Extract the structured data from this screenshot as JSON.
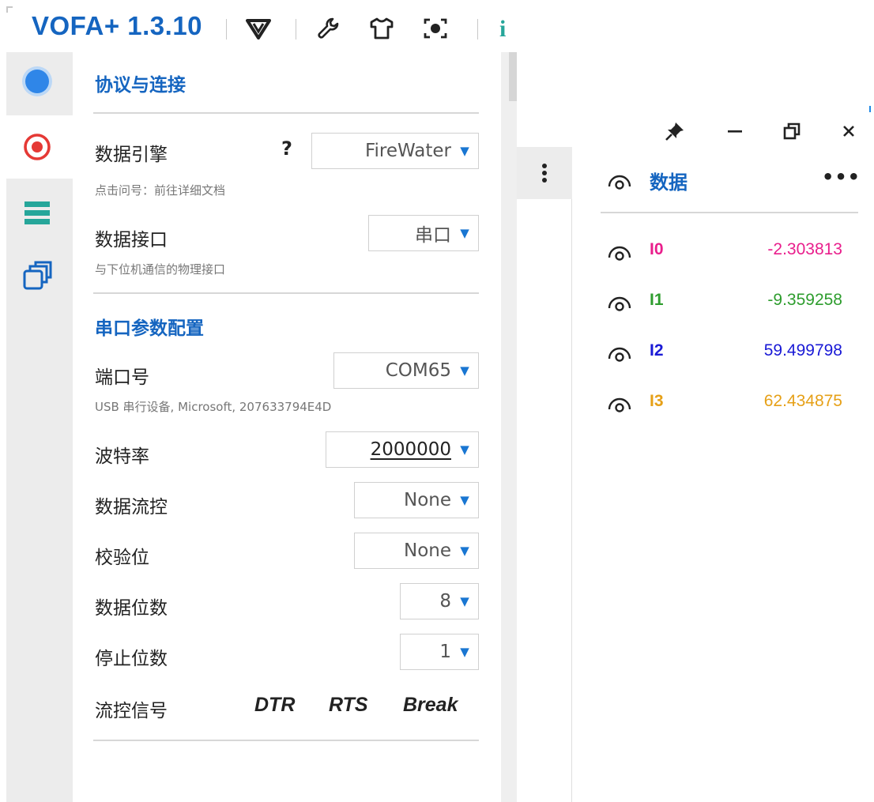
{
  "app": {
    "title": "VOFA+ 1.3.10",
    "clip_glyph": "i"
  },
  "toolbar": {
    "icons": [
      "vofa-logo-icon",
      "wrench-icon",
      "shirt-icon",
      "record-icon"
    ]
  },
  "rail": {
    "icons": [
      "blue-dot-icon",
      "target-icon",
      "list-icon",
      "windows-icon"
    ],
    "active_index": 1
  },
  "settings": {
    "section_connection": "协议与连接",
    "engine": {
      "label": "数据引擎",
      "help": "?",
      "value": "FireWater",
      "hint": "点击问号：前往详细文档"
    },
    "interface": {
      "label": "数据接口",
      "value": "串口",
      "hint": "与下位机通信的物理接口"
    },
    "section_serial": "串口参数配置",
    "port": {
      "label": "端口号",
      "value": "COM65",
      "hint": "USB 串行设备, Microsoft, 207633794E4D"
    },
    "baud": {
      "label": "波特率",
      "value": "2000000"
    },
    "flow": {
      "label": "数据流控",
      "value": "None"
    },
    "parity": {
      "label": "校验位",
      "value": "None"
    },
    "databits": {
      "label": "数据位数",
      "value": "8"
    },
    "stopbits": {
      "label": "停止位数",
      "value": "1"
    },
    "signals": {
      "label": "流控信号",
      "dtr": "DTR",
      "rts": "RTS",
      "brk": "Break"
    },
    "dropdown_arrow": "▼"
  },
  "window": {
    "pin": "pin-icon",
    "minimize": "minimize-icon",
    "restore": "restore-icon",
    "close": "close-icon"
  },
  "data_panel": {
    "title": "数据",
    "more": "•••",
    "channels": [
      {
        "name": "I0",
        "value": "-2.303813",
        "color": "#e91e8c"
      },
      {
        "name": "I1",
        "value": "-9.359258",
        "color": "#2e9d2e"
      },
      {
        "name": "I2",
        "value": "59.499798",
        "color": "#1a1ad6"
      },
      {
        "name": "I3",
        "value": "62.434875",
        "color": "#e6a017"
      }
    ]
  },
  "colors": {
    "accent": "#1565c0",
    "arrow": "#1976d2",
    "record_red": "#e53935",
    "list_green": "#26a69a"
  }
}
